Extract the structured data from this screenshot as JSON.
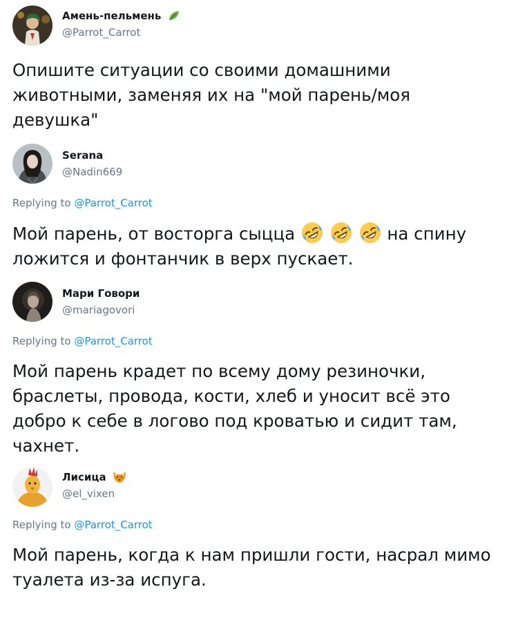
{
  "tweets": [
    {
      "name": "Амень-пельмень",
      "handle": "@Parrot_Carrot",
      "name_badge": "leaf-emoji",
      "text": "Опишите ситуации со своими домашними животными, заменяя их на \"мой парень/моя девушка\""
    },
    {
      "name": "Serana",
      "handle": "@Nadin669",
      "replying_prefix": "Replying to",
      "replying_to": "@Parrot_Carrot",
      "text_before": "Мой парень, от восторга сыцца",
      "emojis": [
        "rofl-emoji",
        "rofl-emoji",
        "rofl-emoji"
      ],
      "text_after": "на спину ложится и фонтанчик в верх пускает."
    },
    {
      "name": "Мари Говори",
      "handle": "@mariagovori",
      "replying_prefix": "Replying to",
      "replying_to": "@Parrot_Carrot",
      "text": "Мой парень крадет по всему дому резиночки, браслеты, провода, кости, хлеб и уносит всё это добро к себе в логово под кроватью и сидит там, чахнет."
    },
    {
      "name": "Лисица",
      "handle": "@el_vixen",
      "name_badge": "fox-emoji",
      "replying_prefix": "Replying to",
      "replying_to": "@Parrot_Carrot",
      "text": "Мой парень, когда к нам пришли гости, насрал мимо туалета из-за испуга."
    }
  ],
  "colors": {
    "text": "#14171a",
    "secondary": "#657786",
    "link": "#1b95e0"
  }
}
